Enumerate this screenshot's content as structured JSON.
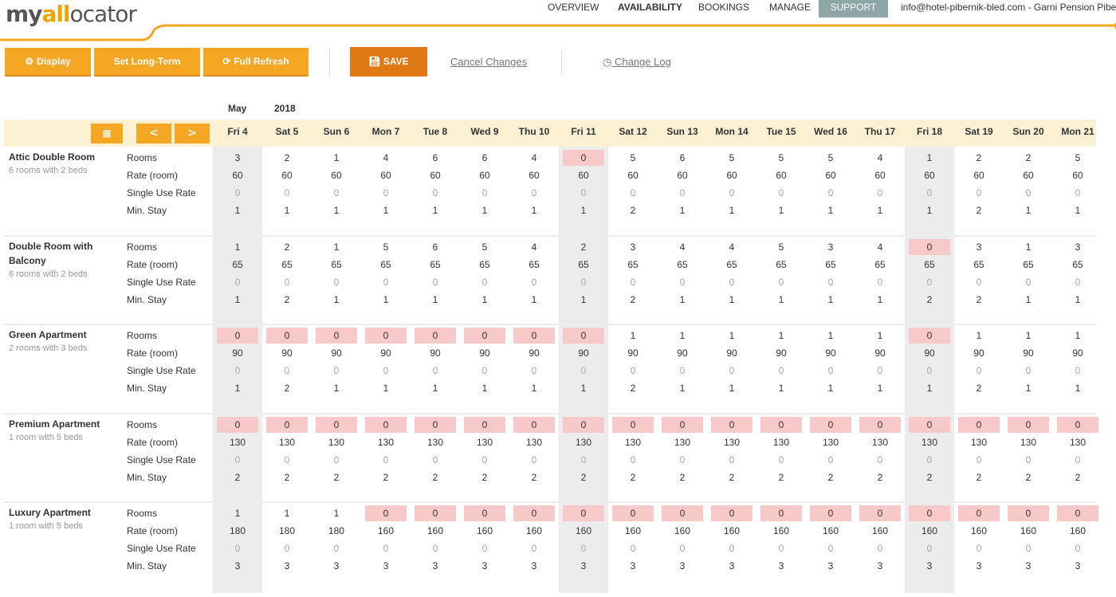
{
  "logo": {
    "part1": "my",
    "part2": "all",
    "part3": "ocator"
  },
  "nav": [
    {
      "label": "OVERVIEW",
      "active": false
    },
    {
      "label": "AVAILABILITY",
      "active": true
    },
    {
      "label": "BOOKINGS",
      "active": false
    },
    {
      "label": "MANAGE",
      "active": false
    },
    {
      "label": "SUPPORT",
      "active": false
    }
  ],
  "account": "info@hotel-pibernik-bled.com - Garni Pension Pibernik",
  "toolbar": {
    "display_label": "Display",
    "longterm_label": "Set Long-Term",
    "refresh_label": "Full Refresh",
    "save_label": "SAVE",
    "cancel_label": "Cancel Changes",
    "changelog_label": "Change Log"
  },
  "month": {
    "name": "May",
    "year": "2018"
  },
  "nav_prev": "<",
  "nav_next": ">",
  "dates": [
    "Fri 4",
    "Sat 5",
    "Sun 6",
    "Mon 7",
    "Tue 8",
    "Wed 9",
    "Thu 10",
    "Fri 11",
    "Sat 12",
    "Sun 13",
    "Mon 14",
    "Tue 15",
    "Wed 16",
    "Thu 17",
    "Fri 18",
    "Sat 19",
    "Sun 20",
    "Mon 21"
  ],
  "weekend_columns": [
    0,
    7,
    14
  ],
  "row_labels": [
    "Rooms",
    "Rate (room)",
    "Single Use Rate",
    "Min. Stay"
  ],
  "rooms": [
    {
      "name": "Attic Double Room",
      "desc": "6 rooms with 2 beds",
      "availability": [
        "3",
        "2",
        "1",
        "4",
        "6",
        "6",
        "4",
        "0",
        "5",
        "6",
        "5",
        "5",
        "5",
        "4",
        "1",
        "2",
        "2",
        "5"
      ],
      "rate": [
        "60",
        "60",
        "60",
        "60",
        "60",
        "60",
        "60",
        "60",
        "60",
        "60",
        "60",
        "60",
        "60",
        "60",
        "60",
        "60",
        "60",
        "60"
      ],
      "single_use": [
        "0",
        "0",
        "0",
        "0",
        "0",
        "0",
        "0",
        "0",
        "0",
        "0",
        "0",
        "0",
        "0",
        "0",
        "0",
        "0",
        "0",
        "0"
      ],
      "min_stay": [
        "1",
        "1",
        "1",
        "1",
        "1",
        "1",
        "1",
        "1",
        "2",
        "1",
        "1",
        "1",
        "1",
        "1",
        "1",
        "2",
        "1",
        "1"
      ]
    },
    {
      "name": "Double Room with Balcony",
      "desc": "6 rooms with 2 beds",
      "availability": [
        "1",
        "2",
        "1",
        "5",
        "6",
        "5",
        "4",
        "2",
        "3",
        "4",
        "4",
        "5",
        "3",
        "4",
        "0",
        "3",
        "1",
        "3"
      ],
      "rate": [
        "65",
        "65",
        "65",
        "65",
        "65",
        "65",
        "65",
        "65",
        "65",
        "65",
        "65",
        "65",
        "65",
        "65",
        "65",
        "65",
        "65",
        "65"
      ],
      "single_use": [
        "0",
        "0",
        "0",
        "0",
        "0",
        "0",
        "0",
        "0",
        "0",
        "0",
        "0",
        "0",
        "0",
        "0",
        "0",
        "0",
        "0",
        "0"
      ],
      "min_stay": [
        "1",
        "2",
        "1",
        "1",
        "1",
        "1",
        "1",
        "1",
        "2",
        "1",
        "1",
        "1",
        "1",
        "1",
        "2",
        "2",
        "1",
        "1"
      ]
    },
    {
      "name": "Green Apartment",
      "desc": "2 rooms with 3 beds",
      "availability": [
        "0",
        "0",
        "0",
        "0",
        "0",
        "0",
        "0",
        "0",
        "1",
        "1",
        "1",
        "1",
        "1",
        "1",
        "0",
        "1",
        "1",
        "1"
      ],
      "rate": [
        "90",
        "90",
        "90",
        "90",
        "90",
        "90",
        "90",
        "90",
        "90",
        "90",
        "90",
        "90",
        "90",
        "90",
        "90",
        "90",
        "90",
        "90"
      ],
      "single_use": [
        "0",
        "0",
        "0",
        "0",
        "0",
        "0",
        "0",
        "0",
        "0",
        "0",
        "0",
        "0",
        "0",
        "0",
        "0",
        "0",
        "0",
        "0"
      ],
      "min_stay": [
        "1",
        "2",
        "1",
        "1",
        "1",
        "1",
        "1",
        "1",
        "2",
        "1",
        "1",
        "1",
        "1",
        "1",
        "1",
        "2",
        "1",
        "1"
      ]
    },
    {
      "name": "Premium Apartment",
      "desc": "1 room with 5 beds",
      "availability": [
        "0",
        "0",
        "0",
        "0",
        "0",
        "0",
        "0",
        "0",
        "0",
        "0",
        "0",
        "0",
        "0",
        "0",
        "0",
        "0",
        "0",
        "0"
      ],
      "rate": [
        "130",
        "130",
        "130",
        "130",
        "130",
        "130",
        "130",
        "130",
        "130",
        "130",
        "130",
        "130",
        "130",
        "130",
        "130",
        "130",
        "130",
        "130"
      ],
      "single_use": [
        "0",
        "0",
        "0",
        "0",
        "0",
        "0",
        "0",
        "0",
        "0",
        "0",
        "0",
        "0",
        "0",
        "0",
        "0",
        "0",
        "0",
        "0"
      ],
      "min_stay": [
        "2",
        "2",
        "2",
        "2",
        "2",
        "2",
        "2",
        "2",
        "2",
        "2",
        "2",
        "2",
        "2",
        "2",
        "2",
        "2",
        "2",
        "2"
      ]
    },
    {
      "name": "Luxury Apartment",
      "desc": "1 room with 5 beds",
      "availability": [
        "1",
        "1",
        "1",
        "0",
        "0",
        "0",
        "0",
        "0",
        "0",
        "0",
        "0",
        "0",
        "0",
        "0",
        "0",
        "0",
        "0",
        "0"
      ],
      "rate": [
        "180",
        "180",
        "180",
        "160",
        "160",
        "160",
        "160",
        "160",
        "160",
        "160",
        "160",
        "160",
        "160",
        "160",
        "160",
        "160",
        "160",
        "160"
      ],
      "single_use": [
        "0",
        "0",
        "0",
        "0",
        "0",
        "0",
        "0",
        "0",
        "0",
        "0",
        "0",
        "0",
        "0",
        "0",
        "0",
        "0",
        "0",
        "0"
      ],
      "min_stay": [
        "3",
        "3",
        "3",
        "3",
        "3",
        "3",
        "3",
        "3",
        "3",
        "3",
        "3",
        "3",
        "3",
        "3",
        "3",
        "3",
        "3",
        "3"
      ]
    }
  ],
  "colors": {
    "accent": "#f5a623",
    "save": "#e07814",
    "header_band": "#fdf1d4",
    "weekend": "#ececec",
    "zero_pill": "#f8c9c9",
    "support_tab": "#8fa6a6"
  }
}
